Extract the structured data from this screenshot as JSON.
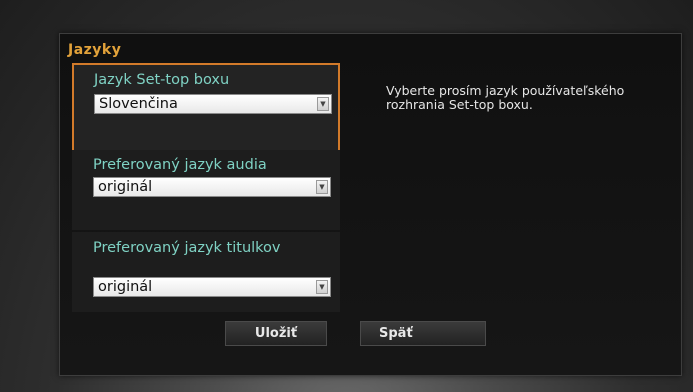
{
  "panel": {
    "title": "Jazyky"
  },
  "fields": [
    {
      "label": "Jazyk Set-top boxu",
      "value": "Slovenčina"
    },
    {
      "label": "Preferovaný jazyk audia",
      "value": "originál"
    },
    {
      "label": "Preferovaný jazyk titulkov",
      "value": "originál"
    }
  ],
  "help": {
    "text": "Vyberte prosím jazyk používateľského rozhrania Set-top boxu."
  },
  "buttons": {
    "save_label": "Uložiť",
    "back_label": "Späť"
  },
  "colors": {
    "accent": "#d27a2a",
    "title": "#e2a23a",
    "label": "#7fd2c4"
  },
  "icons": {
    "dropdown": "chevron-down-icon"
  }
}
